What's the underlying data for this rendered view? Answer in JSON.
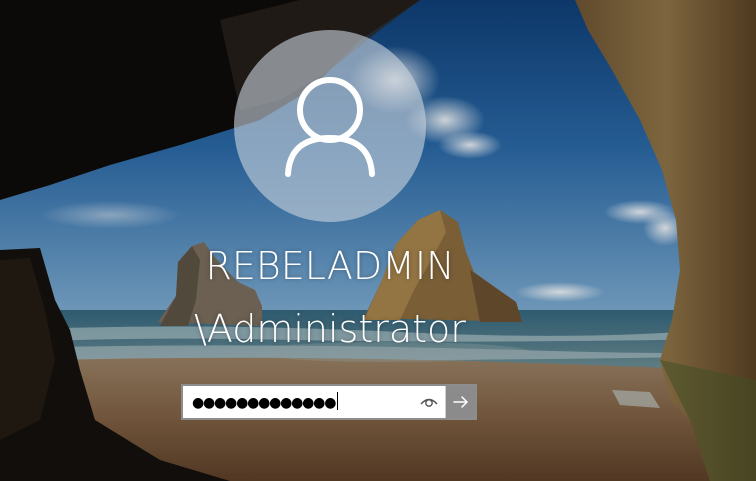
{
  "login": {
    "user_line1": "REBELADMIN",
    "user_line2": "\\Administrator",
    "password_masked": "●●●●●●●●●●●●●",
    "password_length": 13
  },
  "icons": {
    "avatar": "user-silhouette-icon",
    "reveal": "eye-icon",
    "submit": "arrow-right-icon"
  },
  "colors": {
    "password_box_border": "#8d8d8d",
    "submit_button_bg": "#8b8b8b",
    "text": "#ffffff"
  }
}
